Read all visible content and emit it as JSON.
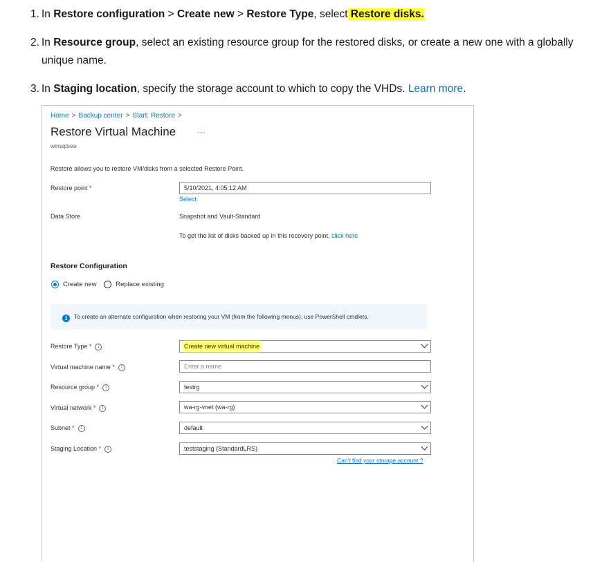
{
  "steps": [
    {
      "num": "1.",
      "prefix": "In ",
      "b1": "Restore configuration",
      "mid1": " > ",
      "b2": "Create new",
      "mid2": " > ",
      "b3": "Restore Type",
      "mid3": ", select",
      "highlight": " Restore disks."
    },
    {
      "num": "2.",
      "prefix": "In ",
      "b1": "Resource group",
      "rest": ", select an existing resource group for the restored disks, or create a new one with a globally unique name."
    },
    {
      "num": "3.",
      "prefix": "In ",
      "b1": "Staging location",
      "rest": ", specify the storage account to which to copy the VHDs. ",
      "link": "Learn more",
      "end": "."
    }
  ],
  "screenshot": {
    "breadcrumb": [
      "Home",
      "Backup center",
      "Start: Restore"
    ],
    "breadcrumb_sep": ">",
    "title": "Restore Virtual Machine",
    "ellipsis": "···",
    "subtitle": "winsqlsea",
    "intro": "Restore allows you to restore VM/disks from a selected Restore Point.",
    "restore_point": {
      "label": "Restore point",
      "value": "5/10/2021, 4:05:12 AM",
      "select_link": "Select"
    },
    "data_store": {
      "label": "Data Store",
      "value": "Snapshot and Vault-Standard"
    },
    "disks_note": {
      "text": "To get the list of disks backed up in this recovery point, ",
      "link": "click here"
    },
    "section_title": "Restore Configuration",
    "radios": [
      {
        "label": "Create new",
        "selected": true
      },
      {
        "label": "Replace existing",
        "selected": false
      }
    ],
    "info_text": "To create an alternate configuration when restoring your VM (from the following menus), use PowerShell cmdlets.",
    "required_mark": "*",
    "info_icon": "info-circle-icon",
    "fields": [
      {
        "label": "Restore Type",
        "value": "Create new virtual machine",
        "dropdown": true,
        "highlighted": true
      },
      {
        "label": "Virtual machine name",
        "placeholder": "Enter a name",
        "dropdown": false
      },
      {
        "label": "Resource group",
        "value": "testrg",
        "dropdown": true
      },
      {
        "label": "Virtual network",
        "value": "wa-rg-vnet (wa-rg)",
        "dropdown": true
      },
      {
        "label": "Subnet",
        "value": "default",
        "dropdown": true
      },
      {
        "label": "Staging Location",
        "value": "teststaging (StandardLRS)",
        "dropdown": true
      }
    ],
    "cant_find_link": "Can't find your storage account ?",
    "colors": {
      "link": "#0078d4",
      "highlight": "#ffff33",
      "required": "#a4262c",
      "info_bg": "#f0f6fb"
    }
  }
}
